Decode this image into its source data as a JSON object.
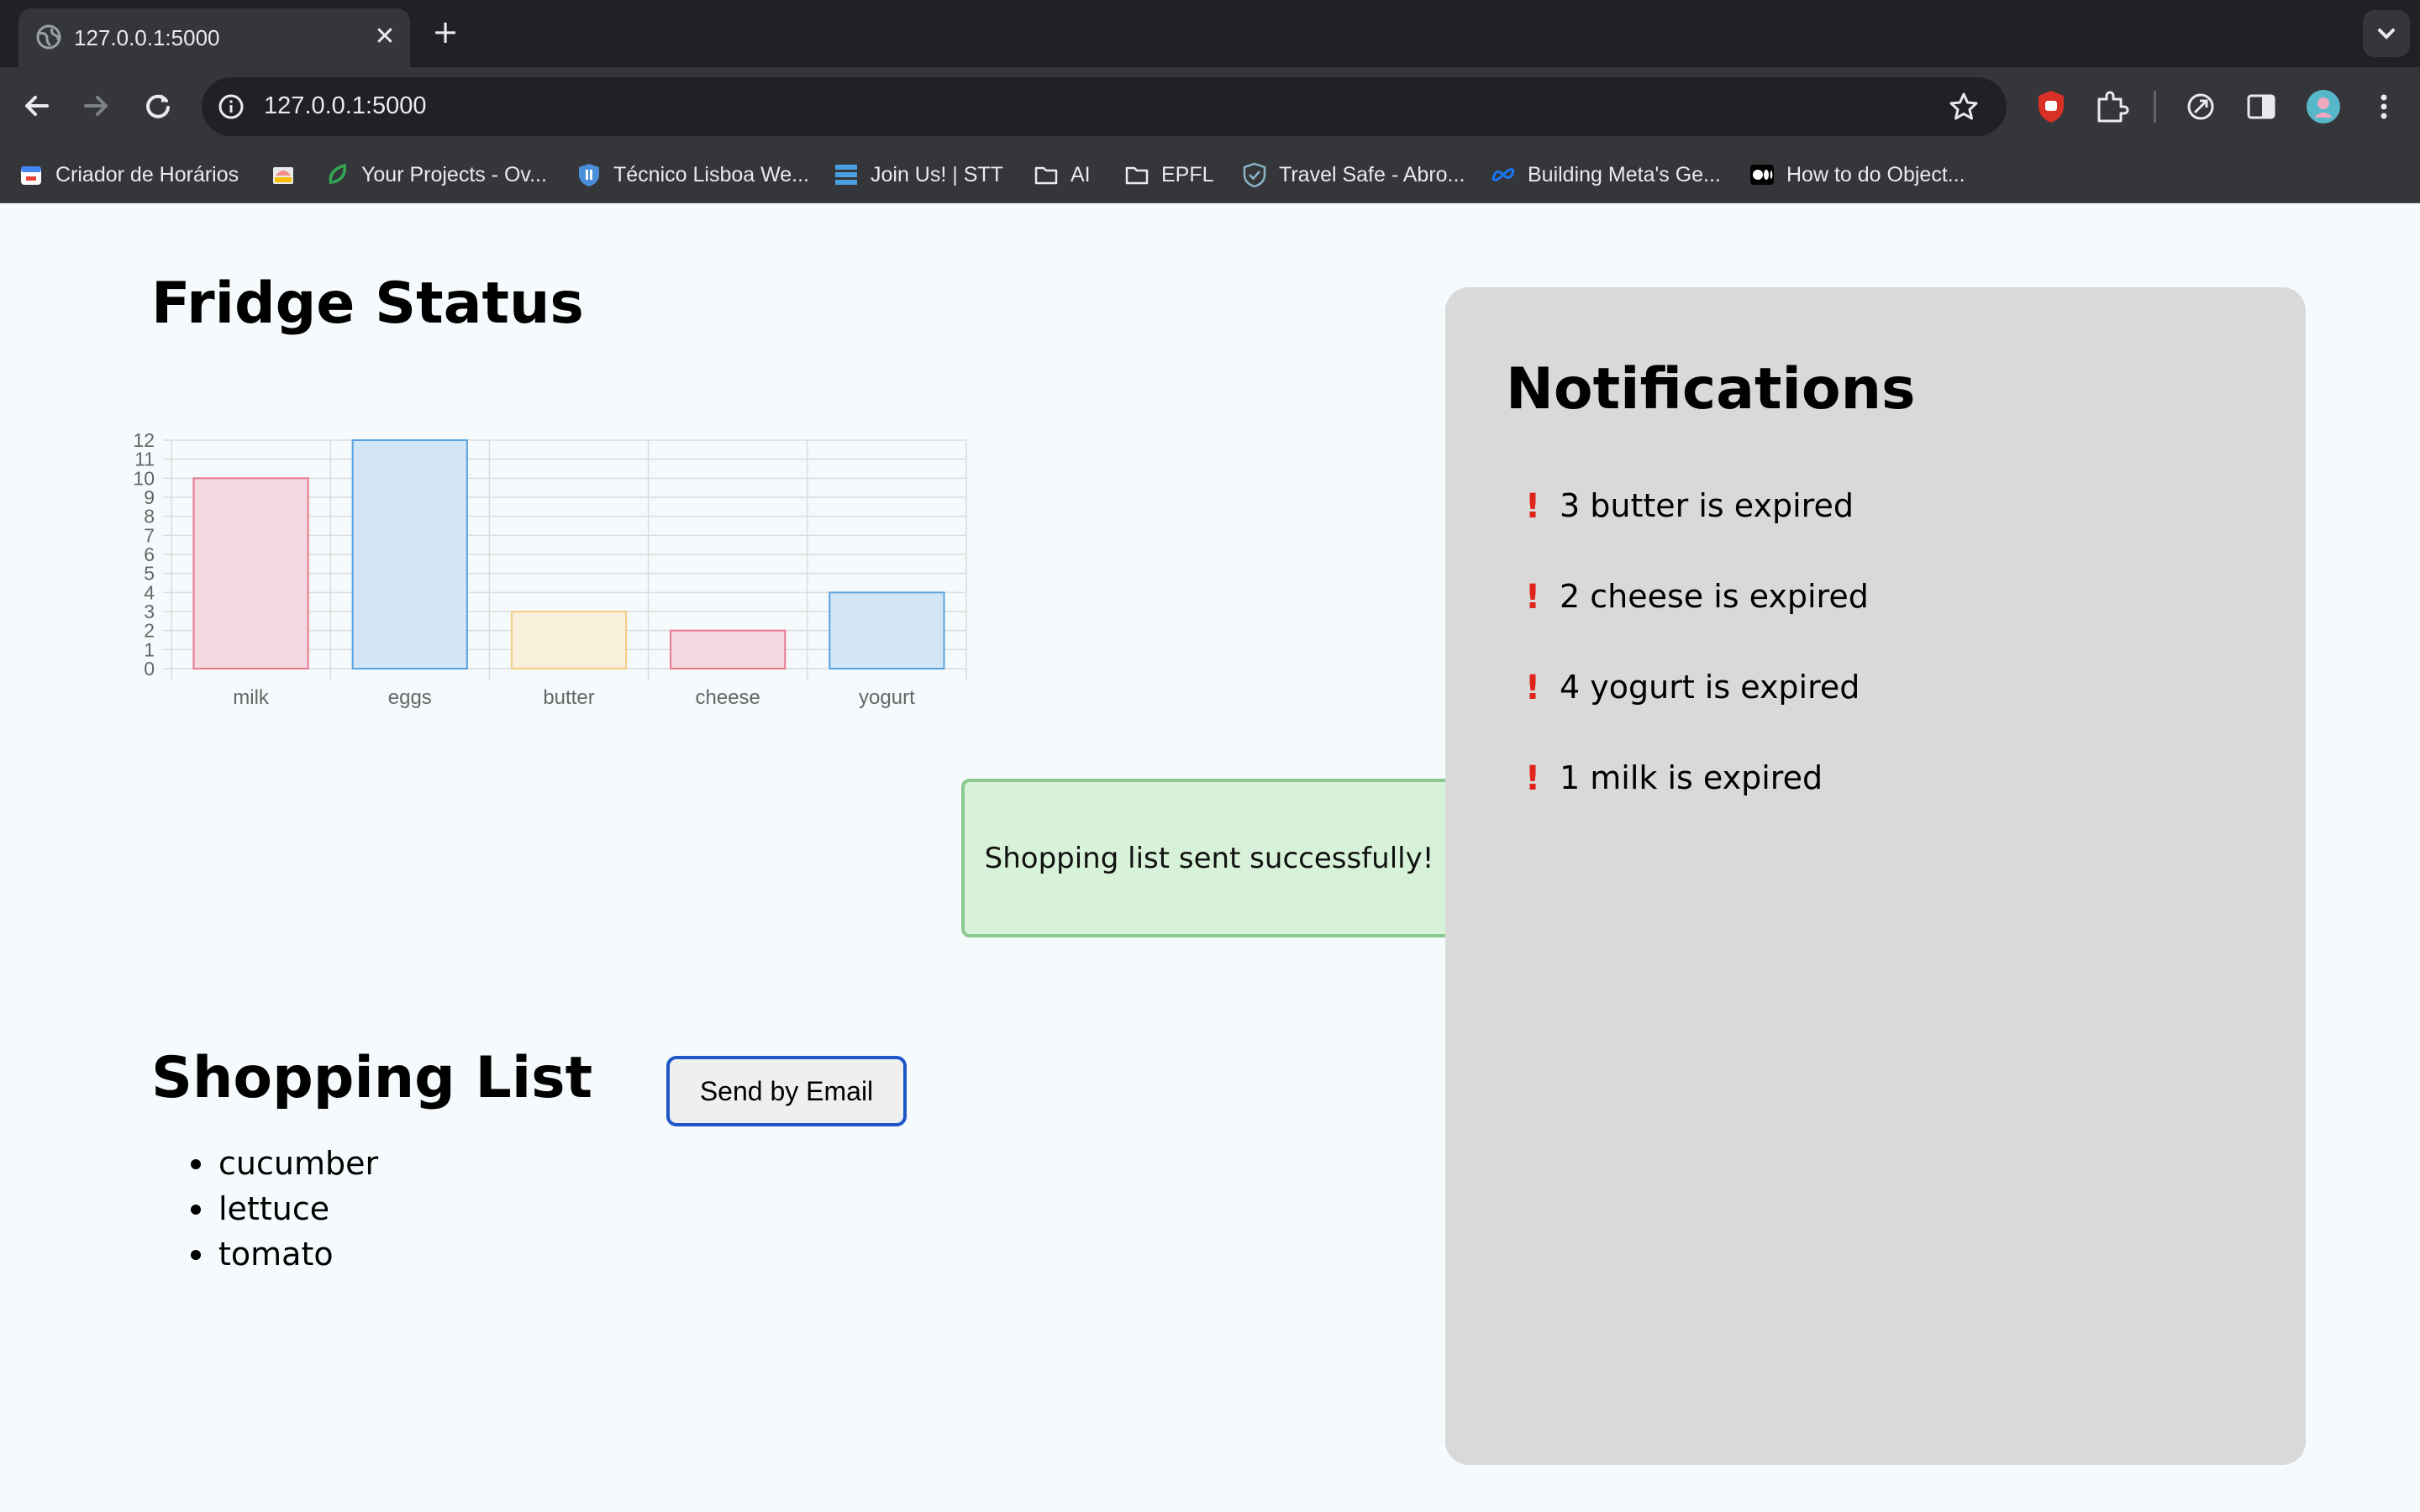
{
  "browser": {
    "tab_title": "127.0.0.1:5000",
    "tab_close": "✕",
    "new_tab": "+",
    "url": "127.0.0.1:5000",
    "icons": [
      "globe-icon",
      "back-icon",
      "forward-icon",
      "reload-icon",
      "site-info-icon",
      "star-icon",
      "extension-shield-icon",
      "puzzle-icon",
      "leaf-icon",
      "sidebar-icon",
      "profile-avatar",
      "kebab-menu-icon"
    ]
  },
  "bookmarks": [
    {
      "label": "Criador de Horários",
      "icon": "calendar-icon"
    },
    {
      "label": "",
      "icon": "inbox-icon"
    },
    {
      "label": "Your Projects - Ov...",
      "icon": "leaf-icon"
    },
    {
      "label": "Técnico Lisboa We...",
      "icon": "shield-icon"
    },
    {
      "label": "Join Us! | STT",
      "icon": "grid-icon"
    },
    {
      "label": "AI",
      "icon": "folder-icon"
    },
    {
      "label": "EPFL",
      "icon": "folder-icon"
    },
    {
      "label": "Travel Safe - Abro...",
      "icon": "check-shield-icon"
    },
    {
      "label": "Building Meta's Ge...",
      "icon": "meta-icon"
    },
    {
      "label": "How to do Object...",
      "icon": "medium-icon"
    }
  ],
  "fridge": {
    "title": "Fridge Status"
  },
  "chart_data": {
    "type": "bar",
    "categories": [
      "milk",
      "eggs",
      "butter",
      "cheese",
      "yogurt"
    ],
    "values": [
      10,
      12,
      3,
      2,
      4
    ],
    "ylim": [
      0,
      12
    ],
    "yticks": [
      0,
      1,
      2,
      3,
      4,
      5,
      6,
      7,
      8,
      9,
      10,
      11,
      12
    ],
    "grid": true,
    "colors": {
      "fill": [
        "#f5d9e0",
        "#d3e6f5",
        "#f9f0dc",
        "#f5d9e0",
        "#d3e6f5"
      ],
      "stroke": [
        "#e8788f",
        "#5aa3e0",
        "#f2cf85",
        "#e8788f",
        "#5aa3e0"
      ]
    }
  },
  "toast": {
    "message": "Shopping list sent successfully!"
  },
  "shopping": {
    "title": "Shopping List",
    "button_label": "Send by Email",
    "items": [
      "cucumber",
      "lettuce",
      "tomato"
    ]
  },
  "notifications": {
    "title": "Notifications",
    "marker": "!",
    "items": [
      "3 butter is expired",
      "2 cheese is expired",
      "4 yogurt is expired",
      "1 milk is expired"
    ]
  },
  "colors": {
    "page_bg": "#f5fafc",
    "panel_bg": "#d9d9d9",
    "toast_bg": "#d8f2d9",
    "toast_border": "#8cc98f",
    "button_border": "#1f57c8",
    "alert": "#e0241b"
  }
}
